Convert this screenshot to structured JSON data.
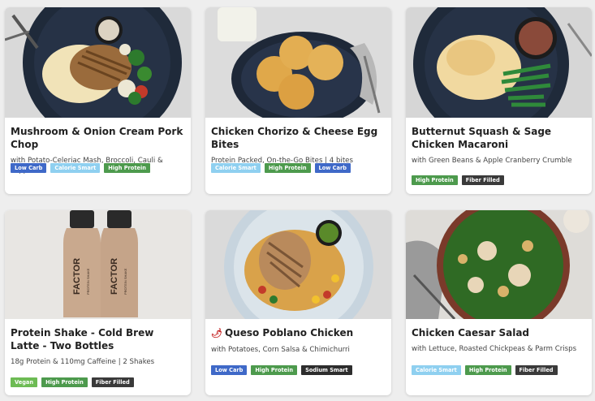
{
  "tag_colors": {
    "Low Carb": "#3f69c8",
    "Calorie Smart": "#8fd0f0",
    "High Protein": "#4d9a4d",
    "Fiber Filled": "#3a3a3a",
    "Vegan": "#6dbb54",
    "Sodium Smart": "#2d2d2d"
  },
  "meals": [
    {
      "title": "Mushroom & Onion Cream Pork Chop",
      "subtitle": "with Potato-Celeriac Mash, Broccoli, Cauli & Peppers",
      "tags": [
        "Low Carb",
        "Calorie Smart",
        "High Protein"
      ]
    },
    {
      "title": "Chicken Chorizo & Cheese Egg Bites",
      "subtitle": "Protein Packed, On-the-Go Bites | 4 bites",
      "tags": [
        "Calorie Smart",
        "High Protein",
        "Low Carb"
      ]
    },
    {
      "title": "Butternut Squash & Sage Chicken Macaroni",
      "subtitle": "with Green Beans & Apple Cranberry Crumble",
      "tags": [
        "High Protein",
        "Fiber Filled"
      ]
    },
    {
      "title": "Protein Shake - Cold Brew Latte - Two Bottles",
      "subtitle": "18g Protein & 110mg Caffeine | 2 Shakes",
      "tags": [
        "Vegan",
        "High Protein",
        "Fiber Filled"
      ]
    },
    {
      "title": "Queso Poblano Chicken",
      "spicy_icon": "chili-pepper-icon",
      "subtitle": "with Potatoes, Corn Salsa & Chimichurri",
      "tags": [
        "Low Carb",
        "High Protein",
        "Sodium Smart"
      ]
    },
    {
      "title": "Chicken Caesar Salad",
      "subtitle": "with Lettuce, Roasted Chickpeas & Parm Crisps",
      "tags": [
        "Calorie Smart",
        "High Protein",
        "Fiber Filled"
      ]
    }
  ],
  "bottle_label": {
    "brand": "FACTOR",
    "product": "PROTEIN SHAKE"
  }
}
